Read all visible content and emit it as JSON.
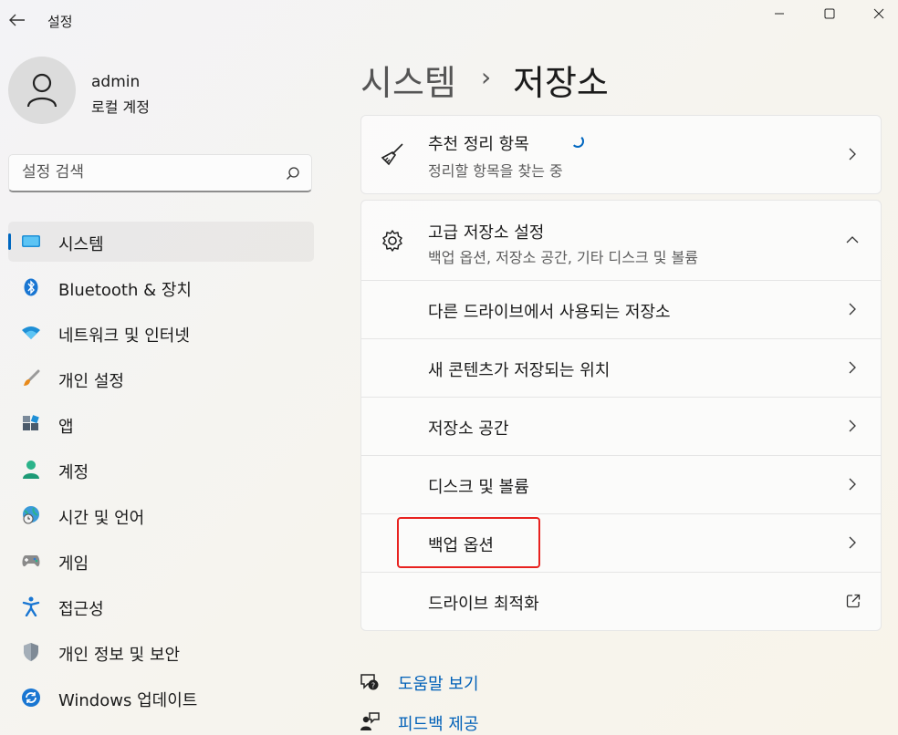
{
  "window": {
    "app_title": "설정",
    "back_icon": "back-arrow-icon",
    "controls": [
      "minimize-icon",
      "maximize-icon",
      "close-icon"
    ]
  },
  "profile": {
    "name": "admin",
    "account_type": "로컬 계정"
  },
  "search": {
    "placeholder": "설정 검색"
  },
  "nav": {
    "selected": "시스템",
    "items": [
      {
        "label": "시스템",
        "icon": "display-icon"
      },
      {
        "label": "Bluetooth & 장치",
        "icon": "bluetooth-icon"
      },
      {
        "label": "네트워크 및 인터넷",
        "icon": "wifi-icon"
      },
      {
        "label": "개인 설정",
        "icon": "brush-icon"
      },
      {
        "label": "앱",
        "icon": "apps-icon"
      },
      {
        "label": "계정",
        "icon": "account-icon"
      },
      {
        "label": "시간 및 언어",
        "icon": "globe-clock-icon"
      },
      {
        "label": "게임",
        "icon": "gamepad-icon"
      },
      {
        "label": "접근성",
        "icon": "accessibility-icon"
      },
      {
        "label": "개인 정보 및 보안",
        "icon": "shield-icon"
      },
      {
        "label": "Windows 업데이트",
        "icon": "update-icon"
      }
    ]
  },
  "breadcrumb": {
    "parent": "시스템",
    "separator": "›",
    "current": "저장소"
  },
  "cleanup_card": {
    "title": "추천 정리 항목",
    "subtitle": "정리할 항목을 찾는 중",
    "icon": "broom-icon"
  },
  "advanced_card": {
    "title": "고급 저장소 설정",
    "subtitle": "백업 옵션, 저장소 공간, 기타 디스크 및 볼륨",
    "icon": "gear-icon",
    "expanded": true,
    "items": [
      {
        "label": "다른 드라이브에서 사용되는 저장소",
        "action": "chevron-right-icon"
      },
      {
        "label": "새 콘텐츠가 저장되는 위치",
        "action": "chevron-right-icon"
      },
      {
        "label": "저장소 공간",
        "action": "chevron-right-icon"
      },
      {
        "label": "디스크 및 볼륨",
        "action": "chevron-right-icon"
      },
      {
        "label": "백업 옵션",
        "action": "chevron-right-icon",
        "highlighted": true
      },
      {
        "label": "드라이브 최적화",
        "action": "external-link-icon"
      }
    ]
  },
  "links": {
    "help": "도움말 보기",
    "feedback": "피드백 제공"
  },
  "colors": {
    "accent": "#0067c0",
    "highlight_box": "#e8221f",
    "link": "#0060b8"
  }
}
